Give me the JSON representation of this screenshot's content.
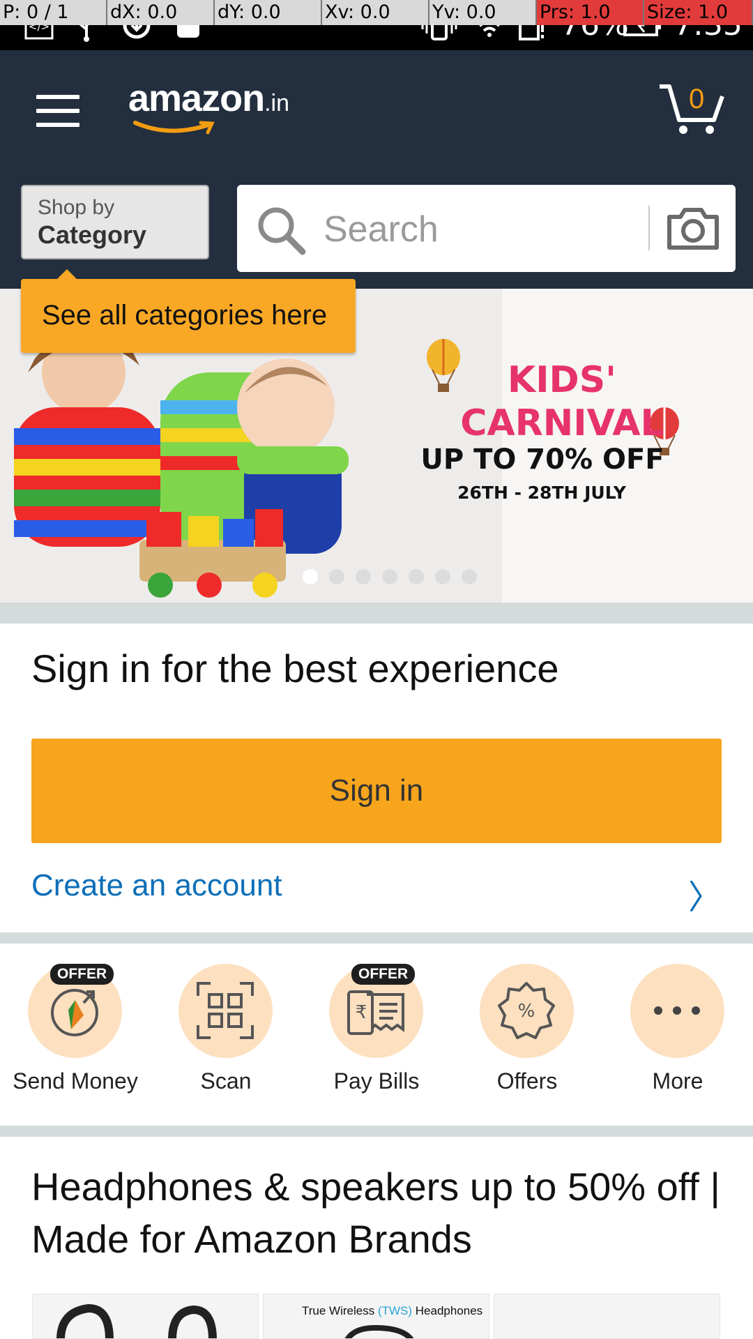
{
  "status_bar": {
    "pointer": "P: 0 / 1",
    "dx": "dX: 0.0",
    "dy": "dY: 0.0",
    "xv": "Xv: 0.0",
    "yv": "Yv: 0.0",
    "prs": "Prs: 1.0",
    "size": "Size: 1.0",
    "battery": "76%",
    "time": "7:35",
    "icons": [
      "code-icon",
      "usb-icon",
      "sync-icon",
      "android-icon",
      "vibrate-icon",
      "wifi-icon",
      "sim-alert-icon",
      "battery-icon"
    ]
  },
  "header": {
    "logo_text": "amazon",
    "logo_suffix": ".in",
    "cart_count": "0",
    "shop_by_small": "Shop by",
    "shop_by_big": "Category",
    "search_placeholder": "Search",
    "colors": {
      "header_bg": "#232f3e",
      "accent": "#f39c12"
    }
  },
  "tooltip": {
    "text": "See all categories here"
  },
  "banner": {
    "title_line1": "KIDS'",
    "title_line2": "CARNIVAL",
    "offer": "UP TO 70% OFF",
    "dates": "26TH - 28TH JULY",
    "slide_count": 7,
    "active_slide": 1
  },
  "signin": {
    "title": "Sign in for the best experience",
    "button_label": "Sign in",
    "create_account": "Create an account",
    "chevron": "〉"
  },
  "quick_actions": [
    {
      "label": "Send Money",
      "badge": "OFFER",
      "icon": "send-money-icon"
    },
    {
      "label": "Scan",
      "badge": "",
      "icon": "scan-qr-icon"
    },
    {
      "label": "Pay Bills",
      "badge": "OFFER",
      "icon": "bill-icon"
    },
    {
      "label": "Offers",
      "badge": "",
      "icon": "percent-badge-icon"
    },
    {
      "label": "More",
      "badge": "",
      "icon": "more-icon"
    }
  ],
  "deals": {
    "title": "Headphones & speakers up to 50% off | Made for Amazon Brands",
    "product_2_prefix": "True Wireless ",
    "product_2_highlight": "(TWS)",
    "product_2_suffix": " Headphones"
  }
}
